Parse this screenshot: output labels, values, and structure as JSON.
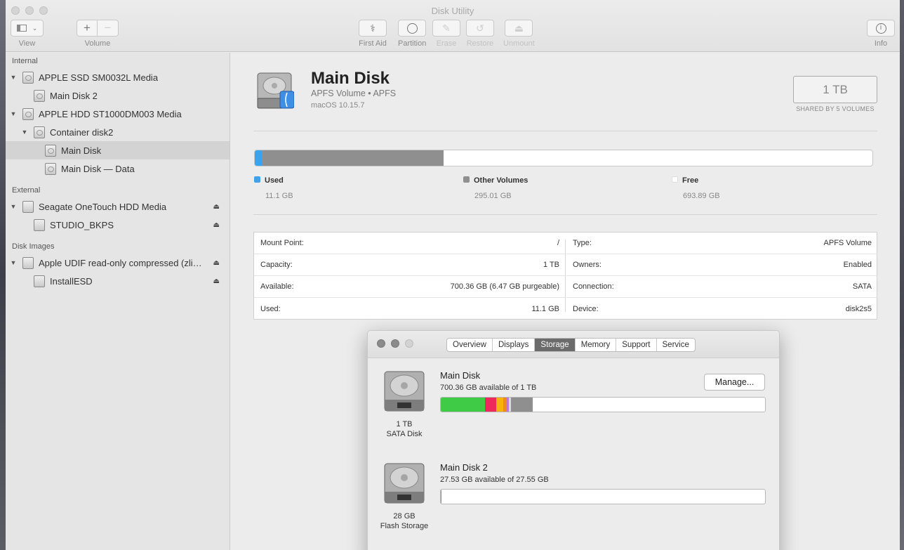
{
  "window": {
    "title": "Disk Utility",
    "toolbar": {
      "view_label": "View",
      "volume_label": "Volume",
      "first_aid": "First Aid",
      "partition": "Partition",
      "erase": "Erase",
      "restore": "Restore",
      "unmount": "Unmount",
      "info": "Info"
    }
  },
  "sidebar": {
    "sections": {
      "internal": "Internal",
      "external": "External",
      "disk_images": "Disk Images"
    },
    "items": {
      "apple_ssd": "APPLE SSD SM0032L Media",
      "main_disk_2": "Main Disk 2",
      "apple_hdd": "APPLE HDD ST1000DM003 Media",
      "container": "Container disk2",
      "main_disk": "Main Disk",
      "main_disk_data": "Main Disk — Data",
      "seagate": "Seagate OneTouch HDD Media",
      "studio": "STUDIO_BKPS",
      "udif": "Apple UDIF read-only compressed (zli…",
      "installesd": "InstallESD"
    }
  },
  "volume": {
    "name": "Main Disk",
    "type_line": "APFS Volume • APFS",
    "os": "macOS 10.15.7",
    "capacity": "1 TB",
    "shared_note": "SHARED BY 5 VOLUMES",
    "usage": {
      "used_fraction": 0.011,
      "other_fraction": 0.295,
      "colors": {
        "used": "#3ba2ee",
        "other": "#8f8f8f",
        "free": "#ffffff"
      }
    },
    "legend": {
      "used_label": "Used",
      "used_value": "11.1 GB",
      "other_label": "Other Volumes",
      "other_value": "295.01 GB",
      "free_label": "Free",
      "free_value": "693.89 GB"
    },
    "info_left": {
      "mount_point_label": "Mount Point:",
      "mount_point_value": "/",
      "capacity_label": "Capacity:",
      "capacity_value": "1 TB",
      "available_label": "Available:",
      "available_value": "700.36 GB (6.47 GB purgeable)",
      "used_label": "Used:",
      "used_value": "11.1 GB"
    },
    "info_right": {
      "type_label": "Type:",
      "type_value": "APFS Volume",
      "owners_label": "Owners:",
      "owners_value": "Enabled",
      "connection_label": "Connection:",
      "connection_value": "SATA",
      "device_label": "Device:",
      "device_value": "disk2s5"
    }
  },
  "system_info": {
    "tabs": {
      "overview": "Overview",
      "displays": "Displays",
      "storage": "Storage",
      "memory": "Memory",
      "support": "Support",
      "service": "Service"
    },
    "disk1": {
      "name": "Main Disk",
      "available": "700.36 GB available of 1 TB",
      "size": "1 TB",
      "kind": "SATA Disk",
      "manage": "Manage...",
      "segments": [
        {
          "fraction": 0.137,
          "color": "#3fcb45"
        },
        {
          "fraction": 0.035,
          "color": "#ee2a5c"
        },
        {
          "fraction": 0.02,
          "color": "#f5b30b"
        },
        {
          "fraction": 0.012,
          "color": "#f08a1a"
        },
        {
          "fraction": 0.006,
          "color": "#b87cd6"
        },
        {
          "fraction": 0.007,
          "color": "#d9d9d9"
        },
        {
          "fraction": 0.066,
          "color": "#8f8f8f"
        }
      ]
    },
    "disk2": {
      "name": "Main Disk 2",
      "available": "27.53 GB available of 27.55 GB",
      "size": "28 GB",
      "kind": "Flash Storage",
      "segments": [
        {
          "fraction": 0.001,
          "color": "#8f8f8f"
        }
      ]
    }
  }
}
